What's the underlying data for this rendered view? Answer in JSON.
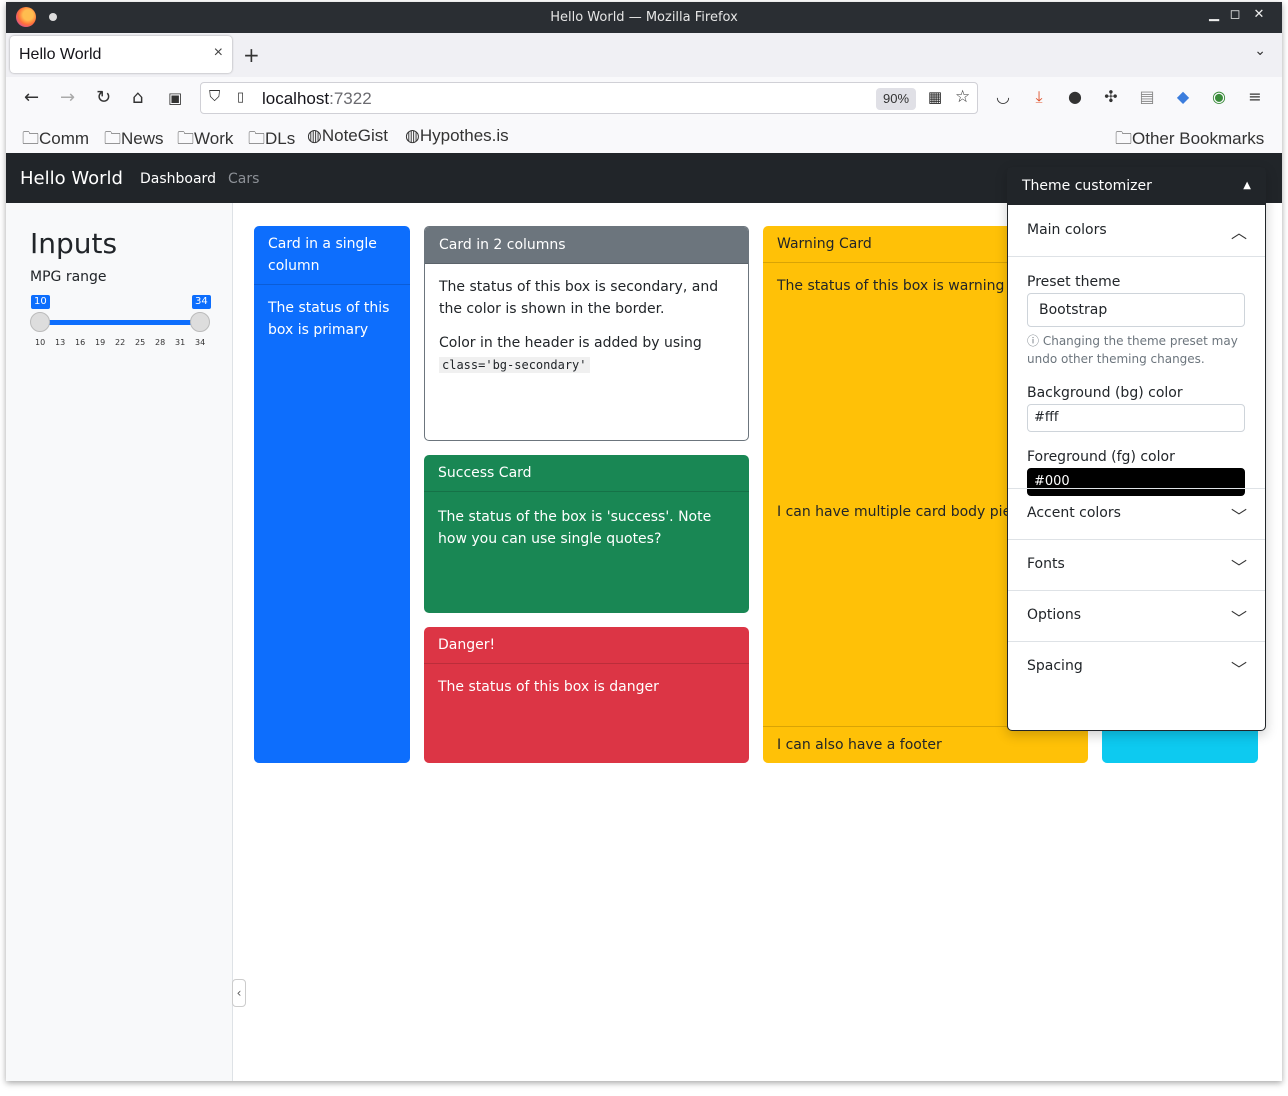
{
  "window": {
    "title": "Hello World — Mozilla Firefox",
    "minimize": "▁",
    "maximize": "◻",
    "close": "✕"
  },
  "tabs": [
    {
      "label": "Hello World"
    }
  ],
  "tab_close": "×",
  "new_tab": "+",
  "tab_list": "⌄",
  "urlbar": {
    "host": "localhost",
    "port": ":7322",
    "zoom": "90%"
  },
  "bookmarks": [
    {
      "label": "Comm",
      "icon": "folder-icon"
    },
    {
      "label": "News",
      "icon": "folder-icon"
    },
    {
      "label": "Work",
      "icon": "folder-icon"
    },
    {
      "label": "DLs",
      "icon": "folder-icon"
    },
    {
      "label": "NoteGist",
      "icon": "globe-icon"
    },
    {
      "label": "Hypothes.is",
      "icon": "globe-icon"
    }
  ],
  "other_bookmarks": "Other Bookmarks",
  "app": {
    "brand": "Hello World",
    "nav": [
      "Dashboard",
      "Cars"
    ]
  },
  "sidebar": {
    "title": "Inputs",
    "slider_label": "MPG range",
    "slider": {
      "min": 10,
      "max": 34,
      "low": "10",
      "high": "34",
      "low_value": 10,
      "high_value": 34
    },
    "ticks": [
      "10",
      "13",
      "16",
      "19",
      "22",
      "25",
      "28",
      "31",
      "34"
    ],
    "collapse": "‹"
  },
  "cards": {
    "primary": {
      "header": "Card in a single column",
      "body": "The status of this box is primary"
    },
    "secondary": {
      "header": "Card in 2 columns",
      "body1": "The status of this box is secondary, and the color is shown in the border.",
      "body2": "Color in the header is added by using",
      "code": "class='bg-secondary'"
    },
    "success": {
      "header": "Success Card",
      "body": "The status of the box is 'success'. Note how you can use single quotes?"
    },
    "danger": {
      "header": "Danger!",
      "body": "The status of this box is danger"
    },
    "warning": {
      "header": "Warning Card",
      "body1": "The status of this box is warning",
      "body2": "I can have multiple card body pieces!",
      "footer": "I can also have a footer"
    }
  },
  "theme_customizer": {
    "title": "Theme customizer",
    "main_colors": "Main colors",
    "preset_label": "Preset theme",
    "preset_value": "Bootstrap",
    "preset_help": "Changing the theme preset may undo other theming changes.",
    "bg_label": "Background (bg) color",
    "bg_value": "#fff",
    "fg_label": "Foreground (fg) color",
    "fg_value": "#000",
    "sections": [
      "Accent colors",
      "Fonts",
      "Options",
      "Spacing"
    ]
  },
  "colors": {
    "primary": "#0d6efd",
    "secondary": "#6c757d",
    "success": "#198754",
    "danger": "#dc3545",
    "warning": "#ffc107",
    "info": "#0dcaf0",
    "navbar": "#212529"
  }
}
